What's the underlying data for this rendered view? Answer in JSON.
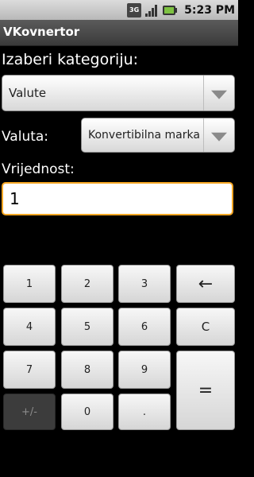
{
  "status": {
    "time": "5:23 PM",
    "network_label": "3G"
  },
  "app": {
    "title": "VKovnertor"
  },
  "category": {
    "label": "Izaberi kategoriju:",
    "selected": "Valute"
  },
  "currency": {
    "label": "Valuta:",
    "selected": "Konvertibilna marka"
  },
  "value": {
    "label": "Vrijednost:",
    "current": "1"
  },
  "keypad": {
    "k1": "1",
    "k2": "2",
    "k3": "3",
    "back": "←",
    "k4": "4",
    "k5": "5",
    "k6": "6",
    "clear": "C",
    "k7": "7",
    "k8": "8",
    "k9": "9",
    "equals": "=",
    "sign": "+/-",
    "k0": "0",
    "dot": "."
  },
  "colors": {
    "focus_border": "#f5a623",
    "background": "#000000"
  }
}
